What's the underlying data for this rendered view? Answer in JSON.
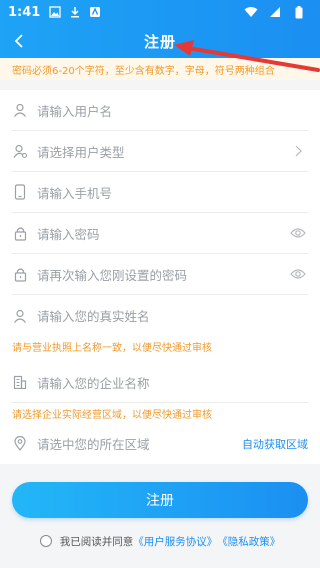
{
  "status_bar": {
    "time": "1:41"
  },
  "nav": {
    "title": "注册"
  },
  "notice": "密码必须6-20个字符，至少含有数字，字母，符号两种组合",
  "fields": {
    "username": {
      "placeholder": "请输入用户名"
    },
    "user_type": {
      "placeholder": "请选择用户类型"
    },
    "phone": {
      "placeholder": "请输入手机号"
    },
    "password": {
      "placeholder": "请输入密码"
    },
    "password_confirm": {
      "placeholder": "请再次输入您刚设置的密码"
    },
    "real_name": {
      "placeholder": "请输入您的真实姓名"
    },
    "company": {
      "placeholder": "请输入您的企业名称"
    },
    "region": {
      "placeholder": "请选中您的所在区域",
      "auto_label": "自动获取区域"
    }
  },
  "hints": {
    "name_hint": "请与营业执照上名称一致，以便尽快通过审核",
    "region_hint": "请选择企业实际经营区域，以便尽快通过审核"
  },
  "submit_label": "注册",
  "agreement": {
    "prefix": "我已阅读并同意",
    "service": "《用户服务协议》",
    "privacy": "《隐私政策》"
  },
  "colors": {
    "primary": "#1b8ff2",
    "warning": "#f09a2b"
  }
}
